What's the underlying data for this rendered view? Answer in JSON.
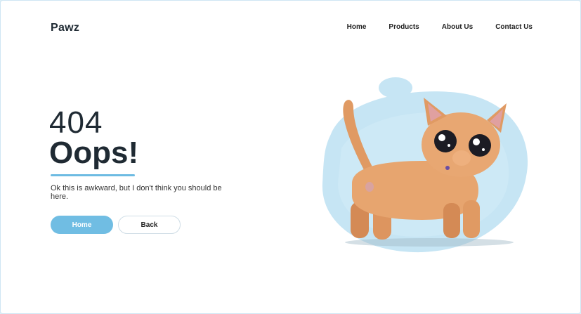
{
  "brand": {
    "name": "Pawz"
  },
  "nav": {
    "items": [
      {
        "label": "Home"
      },
      {
        "label": "Products"
      },
      {
        "label": "About Us"
      },
      {
        "label": "Contact Us"
      }
    ]
  },
  "hero": {
    "code": "404",
    "headline": "Oops!",
    "message": "Ok this is awkward, but I don't think you should be here.",
    "home_button": "Home",
    "back_button": "Back"
  },
  "illustration": {
    "icon": "cat-illustration",
    "blob_color": "#c6e5f4",
    "cat_color": "#e3a06b"
  }
}
